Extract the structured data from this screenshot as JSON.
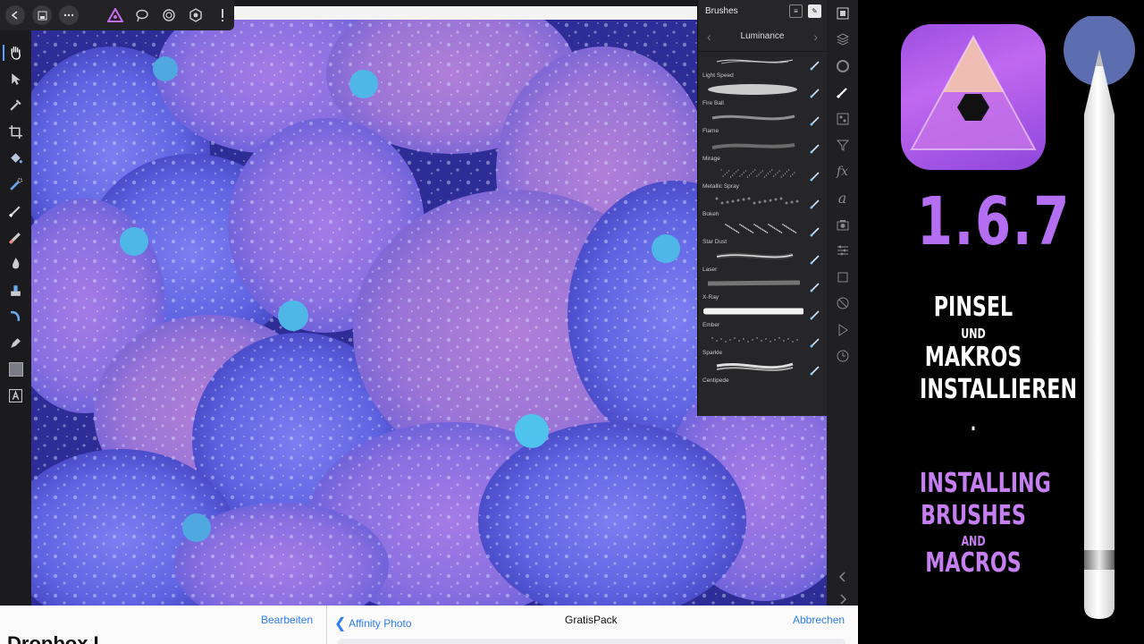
{
  "top_toolbar": {
    "buttons": [
      "back-icon",
      "save-icon",
      "more-icon",
      "photo-persona-icon",
      "liquify-persona-icon",
      "develop-persona-icon",
      "tone-mapping-persona-icon",
      "export-persona-icon"
    ]
  },
  "left_tools": [
    "hand-icon",
    "move-icon",
    "color-picker-icon",
    "crop-icon",
    "flood-fill-icon",
    "selection-brush-icon",
    "paint-brush-icon",
    "erase-brush-icon",
    "dodge-burn-icon",
    "clone-icon",
    "healing-icon",
    "pen-icon",
    "color-well",
    "text-icon"
  ],
  "brushes_panel": {
    "title": "Brushes",
    "category": "Luminance",
    "brushes": [
      {
        "name": "Light Speed"
      },
      {
        "name": "Fire Ball"
      },
      {
        "name": "Flame"
      },
      {
        "name": "Mirage"
      },
      {
        "name": "Metallic Spray"
      },
      {
        "name": "Bokeh"
      },
      {
        "name": "Star Dust"
      },
      {
        "name": "Laser"
      },
      {
        "name": "X-Ray"
      },
      {
        "name": "Ember"
      },
      {
        "name": "Sparkle"
      },
      {
        "name": "Centipede"
      }
    ]
  },
  "right_studio": [
    "navigator-icon",
    "layers-icon",
    "adjustments-icon",
    "brushes-icon",
    "channels-icon",
    "filters-icon",
    "fx-icon",
    "text-styles-icon",
    "camera-icon",
    "transform-icon",
    "selection-icon",
    "block-icon",
    "play-macro-icon",
    "history-icon",
    "collapse-left-icon",
    "collapse-right-icon"
  ],
  "files_bar": {
    "edit": "Bearbeiten",
    "back": "Affinity Photo",
    "title": "GratisPack",
    "cancel": "Abbrechen",
    "partial_heading": "Dropbox I"
  },
  "promo": {
    "version": "1.6.7",
    "line1": "PINSEL",
    "line2": "UND",
    "line3": "MAKROS",
    "line4": "INSTALLIEREN",
    "dot": ".",
    "line5": "INSTALLING",
    "line6": "BRUSHES",
    "line7": "AND",
    "line8": "MACROS",
    "accent": "#b46ef2"
  }
}
